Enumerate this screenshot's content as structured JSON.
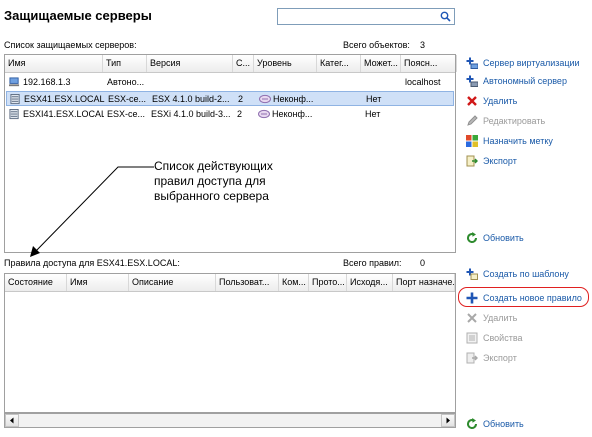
{
  "title": "Защищаемые серверы",
  "search": {
    "placeholder": ""
  },
  "servers": {
    "caption": "Список защищаемых серверов:",
    "count_label": "Всего объектов:",
    "count": "3",
    "columns": [
      "Имя",
      "Тип",
      "Версия",
      "С...",
      "Уровень",
      "Катег...",
      "Может...",
      "Поясн..."
    ],
    "rows": [
      {
        "icon": "computer-icon",
        "cells": [
          "192.168.1.3",
          "Автоно...",
          "",
          "",
          "",
          "",
          "",
          "localhost"
        ]
      },
      {
        "icon": "server-icon",
        "cells": [
          "ESX41.ESX.LOCAL",
          "ESX-се...",
          "ESX 4.1.0 build-2...",
          "2",
          "Неконф...",
          "",
          "Нет",
          ""
        ]
      },
      {
        "icon": "server-icon",
        "cells": [
          "ESXI41.ESX.LOCAL",
          "ESX-се...",
          "ESXi 4.1.0 build-3...",
          "2",
          "Неконф...",
          "",
          "Нет",
          ""
        ]
      }
    ],
    "selected_row": 1
  },
  "server_actions": [
    {
      "icon": "add-virtualization-server-icon",
      "label": "Сервер виртуализации",
      "disabled": false
    },
    {
      "icon": "add-standalone-server-icon",
      "label": "Автономный сервер",
      "disabled": false
    },
    {
      "icon": "delete-icon",
      "label": "Удалить",
      "disabled": false
    },
    {
      "icon": "edit-icon",
      "label": "Редактировать",
      "disabled": true
    },
    {
      "icon": "label-icon",
      "label": "Назначить метку",
      "disabled": false
    },
    {
      "icon": "export-icon",
      "label": "Экспорт",
      "disabled": false
    }
  ],
  "refresh_top": "Обновить",
  "annotation": {
    "lines": [
      "Список действующих",
      "правил доступа для",
      "выбранного сервера"
    ]
  },
  "rules": {
    "caption": "Правила доступа для ESX41.ESX.LOCAL:",
    "count_label": "Всего правил:",
    "count": "0",
    "columns": [
      "Состояние",
      "Имя",
      "Описание",
      "Пользоват...",
      "Ком...",
      "Прото...",
      "Исходя...",
      "Порт назначе..."
    ]
  },
  "rule_actions": [
    {
      "icon": "create-from-template-icon",
      "label": "Создать по шаблону",
      "disabled": false
    },
    {
      "icon": "plus-icon",
      "label": "Создать новое правило",
      "disabled": false
    },
    {
      "icon": "delete-icon",
      "label": "Удалить",
      "disabled": true
    },
    {
      "icon": "properties-icon",
      "label": "Свойства",
      "disabled": true
    },
    {
      "icon": "export-icon",
      "label": "Экспорт",
      "disabled": true
    }
  ],
  "refresh_bottom": "Обновить",
  "colors": {
    "link": "#1a5aa8",
    "selection": "#cfe0f7",
    "highlight": "#e02020",
    "disabled": "#9a9a9a"
  }
}
